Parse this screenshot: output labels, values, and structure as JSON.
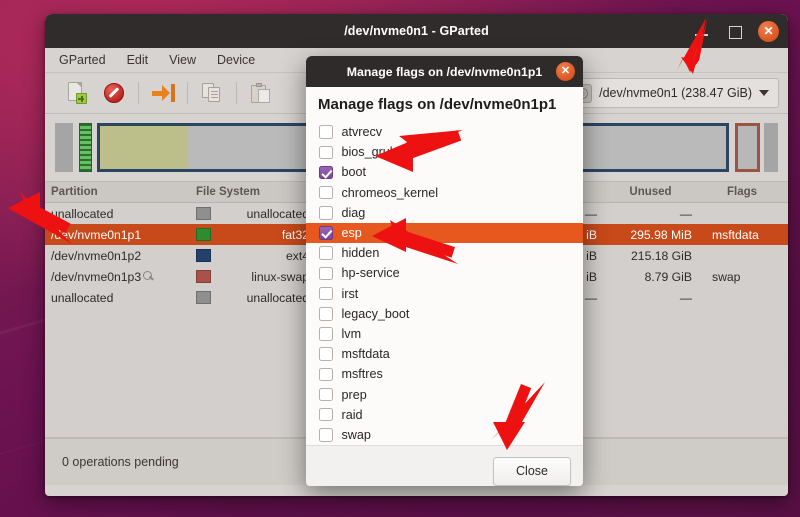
{
  "window": {
    "title": "/dev/nvme0n1 - GParted",
    "controls": {
      "minimize": "–",
      "maximize": "□",
      "close": "✕"
    }
  },
  "menubar": {
    "items": [
      {
        "label": "GParted"
      },
      {
        "label": "Edit"
      },
      {
        "label": "View"
      },
      {
        "label": "Device"
      }
    ]
  },
  "toolbar": {
    "device_selector": {
      "label": "/dev/nvme0n1 (238.47 GiB)"
    }
  },
  "partition_table": {
    "headers": {
      "partition": "Partition",
      "file_system": "File System",
      "unused": "Unused",
      "flags": "Flags"
    },
    "rows": [
      {
        "partition": "unallocated",
        "fs": "unallocated",
        "fs_color": "#8f8f8f",
        "size": "—",
        "unused": "—",
        "flags": "",
        "selected": false,
        "magnifier": false
      },
      {
        "partition": "/dev/nvme0n1p1",
        "fs": "fat32",
        "fs_color": "#2e8b2e",
        "size": "iB",
        "unused": "295.98 MiB",
        "flags": "msftdata",
        "selected": true,
        "magnifier": false
      },
      {
        "partition": "/dev/nvme0n1p2",
        "fs": "ext4",
        "fs_color": "#22416b",
        "size": "iB",
        "unused": "215.18 GiB",
        "flags": "",
        "selected": false,
        "magnifier": false
      },
      {
        "partition": "/dev/nvme0n1p3",
        "fs": "linux-swap",
        "fs_color": "#a8524a",
        "size": "iB",
        "unused": "8.79 GiB",
        "flags": "swap",
        "selected": false,
        "magnifier": true
      },
      {
        "partition": "unallocated",
        "fs": "unallocated",
        "fs_color": "#8f8f8f",
        "size": "—",
        "unused": "—",
        "flags": "",
        "selected": false,
        "magnifier": false
      }
    ]
  },
  "statusbar": {
    "text": "0 operations pending"
  },
  "dialog": {
    "titlebar_title": "Manage flags on /dev/nvme0n1p1",
    "heading": "Manage flags on /dev/nvme0n1p1",
    "close_icon": "✕",
    "flags": [
      {
        "label": "atvrecv",
        "checked": false,
        "highlighted": false
      },
      {
        "label": "bios_grub",
        "checked": false,
        "highlighted": false
      },
      {
        "label": "boot",
        "checked": true,
        "highlighted": false
      },
      {
        "label": "chromeos_kernel",
        "checked": false,
        "highlighted": false
      },
      {
        "label": "diag",
        "checked": false,
        "highlighted": false
      },
      {
        "label": "esp",
        "checked": true,
        "highlighted": true
      },
      {
        "label": "hidden",
        "checked": false,
        "highlighted": false
      },
      {
        "label": "hp-service",
        "checked": false,
        "highlighted": false
      },
      {
        "label": "irst",
        "checked": false,
        "highlighted": false
      },
      {
        "label": "legacy_boot",
        "checked": false,
        "highlighted": false
      },
      {
        "label": "lvm",
        "checked": false,
        "highlighted": false
      },
      {
        "label": "msftdata",
        "checked": false,
        "highlighted": false
      },
      {
        "label": "msftres",
        "checked": false,
        "highlighted": false
      },
      {
        "label": "prep",
        "checked": false,
        "highlighted": false
      },
      {
        "label": "raid",
        "checked": false,
        "highlighted": false
      },
      {
        "label": "swap",
        "checked": false,
        "highlighted": false
      }
    ],
    "close_button": "Close"
  },
  "colors": {
    "accent_orange": "#E95420",
    "selection_orange": "#C8491A",
    "highlight_orange": "#E7581F",
    "checkbox_purple": "#7D4898",
    "annotation_red": "#EE1111"
  }
}
